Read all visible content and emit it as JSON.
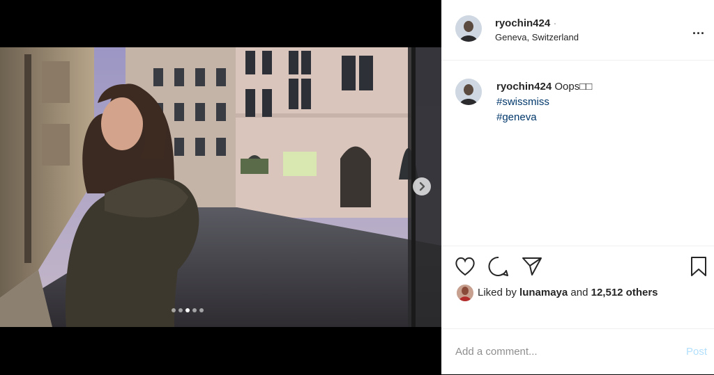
{
  "post": {
    "username": "ryochin424",
    "separator": "·",
    "location": "Geneva, Switzerland",
    "caption_user": "ryochin424",
    "caption_text": "Oops",
    "caption_emoji": "□□",
    "hashtags": [
      "#swissmiss",
      "#geneva"
    ],
    "more_label": "...",
    "carousel": {
      "count": 5,
      "active_index": 2
    }
  },
  "likes": {
    "prefix": "Liked by",
    "user": "lunamaya",
    "middle": "and",
    "count": "12,512 others"
  },
  "comment": {
    "placeholder": "Add a comment...",
    "post_label": "Post"
  },
  "icons": {
    "more": "more-options-icon",
    "like": "heart-icon",
    "comment": "comment-icon",
    "share": "paper-plane-icon",
    "save": "bookmark-icon",
    "next": "chevron-right-icon"
  }
}
